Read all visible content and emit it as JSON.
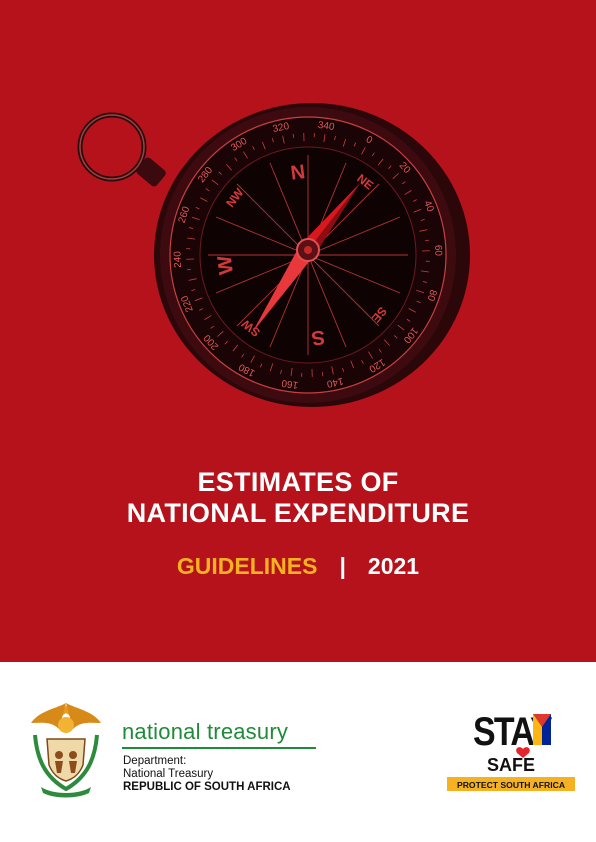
{
  "cover": {
    "title_line1": "ESTIMATES OF",
    "title_line2": "NATIONAL EXPENDITURE",
    "subtitle_left": "GUIDELINES",
    "subtitle_separator": "|",
    "subtitle_right": "2021",
    "background_color": "#b5121b",
    "accent_color": "#f4b223"
  },
  "compass": {
    "icon": "compass-icon",
    "directions": [
      "N",
      "NE",
      "SE",
      "S",
      "SW",
      "W",
      "NW"
    ],
    "degree_labels": [
      "0",
      "20",
      "40",
      "60",
      "80",
      "100",
      "120",
      "140",
      "160",
      "180",
      "200",
      "220",
      "240",
      "260",
      "280",
      "300",
      "320",
      "340"
    ]
  },
  "footer": {
    "brand_name": "national treasury",
    "dept_line1": "Department:",
    "dept_line2": "National Treasury",
    "dept_line3": "REPUBLIC OF SOUTH AFRICA",
    "brand_color": "#1f8b3a",
    "crest_icon": "coat-of-arms-icon",
    "campaign": {
      "word1": "STAY",
      "word2": "SAFE",
      "tagline": "PROTECT SOUTH AFRICA"
    }
  }
}
